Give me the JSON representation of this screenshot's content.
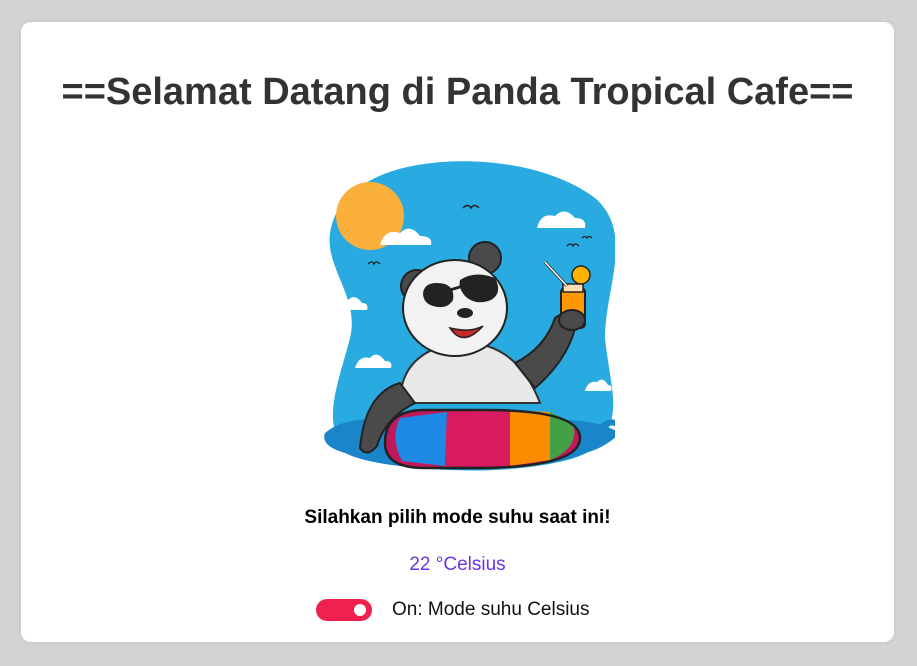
{
  "page": {
    "title": "==Selamat Datang di Panda Tropical Cafe==",
    "prompt": "Silahkan pilih mode suhu saat ini!",
    "temperature": "22 °Celsius",
    "toggle": {
      "state": "on",
      "label": "On: Mode suhu Celsius",
      "color": "#f0204f"
    }
  },
  "illustration": {
    "icon": "panda-with-drink-on-swim-ring-illustration"
  },
  "colors": {
    "background": "#d3d3d3",
    "card": "#ffffff",
    "title": "#333333",
    "temperature": "#6a35e6"
  }
}
